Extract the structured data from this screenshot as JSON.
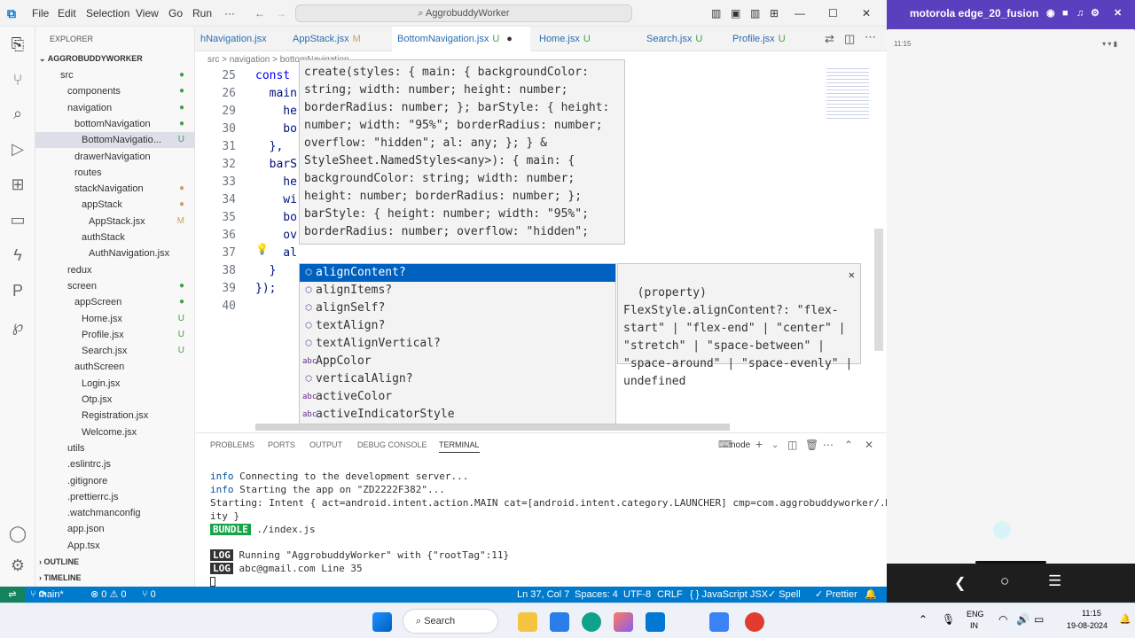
{
  "window": {
    "menus": [
      "File",
      "Edit",
      "Selection",
      "View",
      "Go",
      "Run",
      "···"
    ],
    "search": "AggrobuddyWorker"
  },
  "explorer": {
    "title": "EXPLORER",
    "project": "AGGROBUDDYWORKER",
    "rows": [
      {
        "label": "src",
        "indent": 1,
        "status": "●",
        "color": "#43a047"
      },
      {
        "label": "components",
        "indent": 2,
        "status": "●",
        "color": "#43a047"
      },
      {
        "label": "navigation",
        "indent": 2,
        "status": "●",
        "color": "#43a047"
      },
      {
        "label": "bottomNavigation",
        "indent": 3,
        "status": "●",
        "color": "#43a047"
      },
      {
        "label": "BottomNavigatio...",
        "indent": 4,
        "status": "U",
        "color": "#43a047"
      },
      {
        "label": "drawerNavigation",
        "indent": 3,
        "status": "",
        "color": ""
      },
      {
        "label": "routes",
        "indent": 3,
        "status": "",
        "color": ""
      },
      {
        "label": "stackNavigation",
        "indent": 3,
        "status": "●",
        "color": "#c8a165"
      },
      {
        "label": "appStack",
        "indent": 4,
        "status": "●",
        "color": "#c8a165"
      },
      {
        "label": "AppStack.jsx",
        "indent": 5,
        "status": "M",
        "color": "#c8a165"
      },
      {
        "label": "authStack",
        "indent": 4,
        "status": "",
        "color": ""
      },
      {
        "label": "AuthNavigation.jsx",
        "indent": 5,
        "status": "",
        "color": ""
      },
      {
        "label": "redux",
        "indent": 2,
        "status": "",
        "color": ""
      },
      {
        "label": "screen",
        "indent": 2,
        "status": "●",
        "color": "#43a047"
      },
      {
        "label": "appScreen",
        "indent": 3,
        "status": "●",
        "color": "#43a047"
      },
      {
        "label": "Home.jsx",
        "indent": 4,
        "status": "U",
        "color": "#43a047"
      },
      {
        "label": "Profile.jsx",
        "indent": 4,
        "status": "U",
        "color": "#43a047"
      },
      {
        "label": "Search.jsx",
        "indent": 4,
        "status": "U",
        "color": "#43a047"
      },
      {
        "label": "authScreen",
        "indent": 3,
        "status": "",
        "color": ""
      },
      {
        "label": "Login.jsx",
        "indent": 4,
        "status": "",
        "color": ""
      },
      {
        "label": "Otp.jsx",
        "indent": 4,
        "status": "",
        "color": ""
      },
      {
        "label": "Registration.jsx",
        "indent": 4,
        "status": "",
        "color": ""
      },
      {
        "label": "Welcome.jsx",
        "indent": 4,
        "status": "",
        "color": ""
      },
      {
        "label": "utils",
        "indent": 2,
        "status": "",
        "color": ""
      },
      {
        "label": ".eslintrc.js",
        "indent": 2,
        "status": "",
        "color": ""
      },
      {
        "label": ".gitignore",
        "indent": 2,
        "status": "",
        "color": ""
      },
      {
        "label": ".prettierrc.js",
        "indent": 2,
        "status": "",
        "color": ""
      },
      {
        "label": ".watchmanconfig",
        "indent": 2,
        "status": "",
        "color": ""
      },
      {
        "label": "app.json",
        "indent": 2,
        "status": "",
        "color": ""
      },
      {
        "label": "App.tsx",
        "indent": 2,
        "status": "",
        "color": ""
      }
    ],
    "outline": "OUTLINE",
    "timeline": "TIMELINE"
  },
  "tabs": [
    {
      "label": "hNavigation.jsx",
      "status": ""
    },
    {
      "label": "AppStack.jsx",
      "status": "M"
    },
    {
      "label": "BottomNavigation.jsx",
      "status": "U"
    },
    {
      "label": "Home.jsx",
      "status": "U"
    },
    {
      "label": "Search.jsx",
      "status": "U"
    },
    {
      "label": "Profile.jsx",
      "status": "U"
    }
  ],
  "breadcrumb": "src > navigation > bottomNavigation",
  "code": [
    {
      "n": "25",
      "text": "const"
    },
    {
      "n": "26",
      "text": "  main"
    },
    {
      "n": "29",
      "text": "    he"
    },
    {
      "n": "30",
      "text": "    bo"
    },
    {
      "n": "31",
      "text": "  },"
    },
    {
      "n": "32",
      "text": "  barS"
    },
    {
      "n": "33",
      "text": "    he"
    },
    {
      "n": "34",
      "text": "    wi"
    },
    {
      "n": "35",
      "text": "    bo"
    },
    {
      "n": "36",
      "text": "    ov"
    },
    {
      "n": "37",
      "text": "    al"
    },
    {
      "n": "38",
      "text": "  }"
    },
    {
      "n": "39",
      "text": "});"
    },
    {
      "n": "40",
      "text": ""
    }
  ],
  "hover": "create(styles: { main: { backgroundColor: string; width: number; height: number; borderRadius: number; }; barStyle: { height: number; width: \"95%\"; borderRadius: number; overflow: \"hidden\"; al: any; }; } & StyleSheet.NamedStyles<any>): { main: { backgroundColor: string; width: number; height: number; borderRadius: number; }; barStyle: { height: number; width: \"95%\"; borderRadius: number; overflow: \"hidden\";",
  "suggestions": [
    {
      "icon": "⬡",
      "label": "alignContent?"
    },
    {
      "icon": "⬡",
      "label": "alignItems?"
    },
    {
      "icon": "⬡",
      "label": "alignSelf?"
    },
    {
      "icon": "⬡",
      "label": "textAlign?"
    },
    {
      "icon": "⬡",
      "label": "textAlignVertical?"
    },
    {
      "icon": "abc",
      "label": "AppColor"
    },
    {
      "icon": "⬡",
      "label": "verticalAlign?"
    },
    {
      "icon": "abc",
      "label": "activeColor"
    },
    {
      "icon": "abc",
      "label": "activeIndicatorStyle"
    }
  ],
  "details": "(property) FlexStyle.alignContent?: \"flex-start\" | \"flex-end\" | \"center\" | \"stretch\" | \"space-between\" | \"space-around\" | \"space-evenly\" | undefined",
  "panel": {
    "tabs": [
      "PROBLEMS",
      "PORTS",
      "OUTPUT",
      "DEBUG CONSOLE",
      "TERMINAL"
    ],
    "shell": "node",
    "lines": [
      {
        "tag": "info",
        "text": " Connecting to the development server..."
      },
      {
        "tag": "info",
        "text": " Starting the app on \"ZD2222F382\"..."
      },
      {
        "tag": "",
        "text": "Starting: Intent { act=android.intent.action.MAIN cat=[android.intent.category.LAUNCHER] cmp=com.aggrobuddyworker/.MainActiv"
      },
      {
        "tag": "",
        "text": "ity }"
      }
    ],
    "bundle_label": "BUNDLE",
    "bundle_text": " ./index.js",
    "logs": [
      {
        "tag": "LOG",
        "text": " Running \"AggrobuddyWorker\" with {\"rootTag\":11}"
      },
      {
        "tag": "LOG",
        "text": " abc@gmail.com Line 35"
      }
    ]
  },
  "status": {
    "branch": "main*",
    "errors": "⊗ 0 ⚠ 0",
    "ports": "⑂ 0",
    "position": "Ln 37, Col 7",
    "spaces": "Spaces: 4",
    "encoding": "UTF-8",
    "eol": "CRLF",
    "language": "{ } JavaScript JSX",
    "spell": "✓ Spell",
    "prettier": "✓ Prettier"
  },
  "phone": {
    "title": "motorola edge_20_fusion",
    "time": "11:15"
  },
  "taskbar": {
    "search": "Search",
    "lang1": "ENG",
    "lang2": "IN",
    "time": "11:15",
    "date": "19-08-2024"
  }
}
